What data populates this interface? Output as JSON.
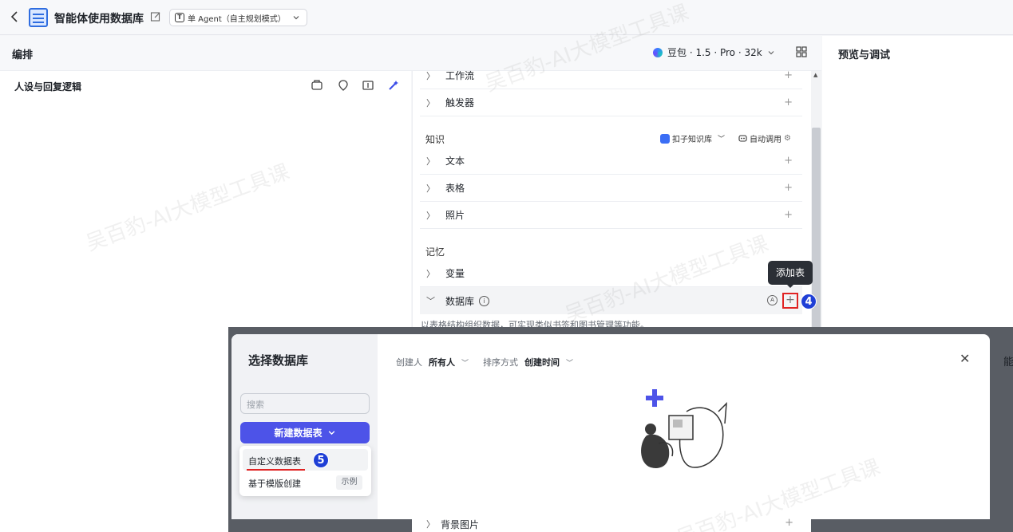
{
  "header": {
    "back_icon": "chevron-left-icon",
    "app_icon": "database-app-icon",
    "title": "智能体使用数据库",
    "edit_icon": "edit-icon",
    "mode_label": "单 Agent（自主规划模式）",
    "mode_icon_char": "T"
  },
  "arrange": {
    "title": "编排",
    "model_label": "豆包 · 1.5 · Pro · 32k",
    "layout_icon": "grid-settings-icon"
  },
  "persona": {
    "title": "人设与回复逻辑",
    "tools": [
      "template-icon",
      "optimize-icon",
      "brackets-icon",
      "magic-icon"
    ]
  },
  "preview": {
    "title": "预览与调试"
  },
  "skills": {
    "workflow": "工作流",
    "trigger": "触发器",
    "knowledge_title": "知识",
    "kb_source": "扣子知识库",
    "auto_call": "自动调用",
    "text": "文本",
    "table": "表格",
    "photo": "照片",
    "memory_title": "记忆",
    "variables": "变量",
    "database": "数据库",
    "database_desc": "以表格结构组织数据，可实现类似书签和图书管理等功能。",
    "add_tooltip": "添加表",
    "bg_image": "背景图片",
    "step_4": "4",
    "step_5": "5",
    "plus": "+"
  },
  "modal": {
    "title": "选择数据库",
    "search_placeholder": "搜索",
    "new_table": "新建数据表",
    "menu": {
      "custom": "自定义数据表",
      "template": "基于模版创建",
      "example": "示例"
    },
    "filter": {
      "creator_label": "创建人",
      "creator_value": "所有人",
      "sort_label": "排序方式",
      "sort_value": "创建时间"
    },
    "close_icon": "close-icon",
    "peek_text": "能"
  },
  "watermark": "吴百豹-AI大模型工具课",
  "colors": {
    "accent": "#4d53e8",
    "highlight_red": "#e02424",
    "badge_blue": "#1f3fd6"
  }
}
